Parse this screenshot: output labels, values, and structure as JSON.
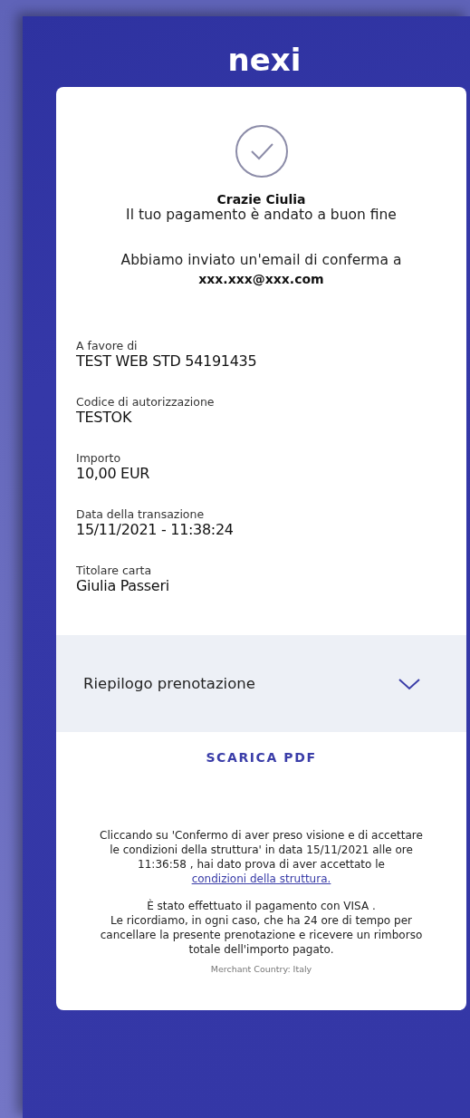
{
  "logo": "nexi",
  "greeting": "Crazie Ciulia",
  "status_message": "Il tuo pagamento è andato a buon fine",
  "email_notice": "Abbiamo inviato un'email di conferma a",
  "email": "xxx.xxx@xxx.com",
  "details": [
    {
      "label": "A favore di",
      "value": "TEST WEB STD 54191435"
    },
    {
      "label": "Codice di autorizzazione",
      "value": "TESTOK"
    },
    {
      "label": "Importo",
      "value": "10,00 EUR"
    },
    {
      "label": "Data della transazione",
      "value": "15/11/2021 - 11:38:24"
    },
    {
      "label": "Titolare carta",
      "value": "Giulia Passeri"
    }
  ],
  "summary": {
    "label": "Riepilogo prenotazione",
    "expanded": false
  },
  "download_button": "SCARICA PDF",
  "terms": {
    "text": "Cliccando su 'Confermo di aver preso visione e di accettare le condizioni della struttura' in data 15/11/2021 alle ore 11:36:58 , hai dato prova di aver accettato le ",
    "link": "condizioni della struttura."
  },
  "payment_notice": [
    "È stato effettuato il pagamento con VISA .",
    "Le ricordiamo, in ogni caso, che ha 24 ore di tempo per cancellare la presente prenotazione e ricevere un rimborso totale dell'importo pagato."
  ],
  "merchant_country": "Merchant Country: Italy"
}
